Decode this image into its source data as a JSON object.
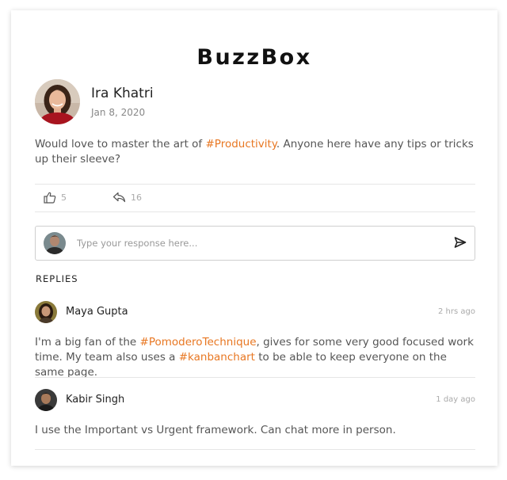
{
  "brand": "BuzzBox",
  "post": {
    "author": "Ira Khatri",
    "date": "Jan 8, 2020",
    "text_before": "Would love to master the art of ",
    "hashtag": "#Productivity",
    "text_after": ". Anyone here have any tips or tricks up their sleeve?",
    "likes": "5",
    "shares": "16"
  },
  "response": {
    "placeholder": "Type your response here..."
  },
  "replies_heading": "REPLIES",
  "replies": [
    {
      "name": "Maya Gupta",
      "time": "2 hrs ago",
      "text_1": "I'm a big fan of the ",
      "hashtag_1": "#PomoderoTechnique",
      "text_2": ", gives for some very good focused work time. My team also uses a ",
      "hashtag_2": "#kanbanchart",
      "text_3": " to be able to keep everyone on the same page."
    },
    {
      "name": "Kabir Singh",
      "time": "1 day ago",
      "text_1": "I use the Important vs Urgent framework. Can chat more in person."
    }
  ],
  "colors": {
    "accent": "#e87722",
    "text": "#555555",
    "muted": "#aaaaaa",
    "divider": "#e6e6e6"
  },
  "icons": [
    "thumbs-up-icon",
    "reply-icon",
    "send-icon"
  ]
}
